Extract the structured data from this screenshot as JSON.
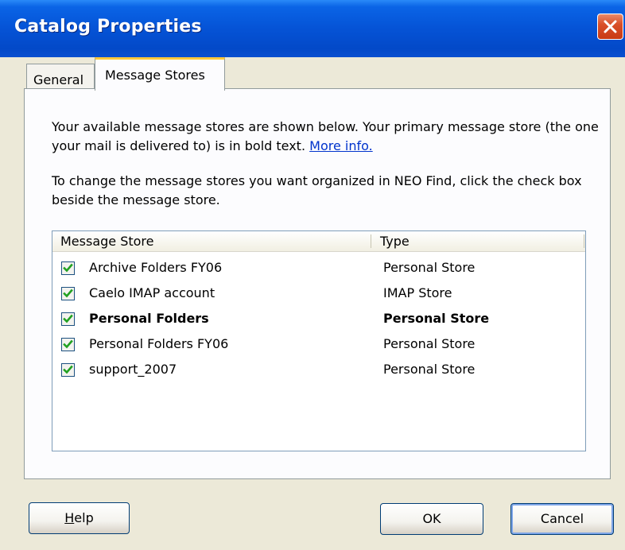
{
  "window": {
    "title": "Catalog Properties"
  },
  "tabs": [
    {
      "label": "General",
      "active": false
    },
    {
      "label": "Message Stores",
      "active": true
    }
  ],
  "content": {
    "para1": "Your available message stores are shown below. Your primary message store (the one your mail is delivered to) is in bold text.",
    "link": "More info.",
    "para2": "To change the message stores you want organized in NEO Find, click the check box beside the message store."
  },
  "list": {
    "columns": [
      "Message Store",
      "Type"
    ],
    "rows": [
      {
        "name": "Archive Folders FY06",
        "type": "Personal Store",
        "checked": true,
        "primary": false
      },
      {
        "name": "Caelo IMAP account",
        "type": "IMAP Store",
        "checked": true,
        "primary": false
      },
      {
        "name": "Personal Folders",
        "type": "Personal Store",
        "checked": true,
        "primary": true
      },
      {
        "name": "Personal Folders FY06",
        "type": "Personal Store",
        "checked": true,
        "primary": false
      },
      {
        "name": "support_2007",
        "type": "Personal Store",
        "checked": true,
        "primary": false
      }
    ]
  },
  "buttons": {
    "help_mnemonic": "H",
    "help_rest": "elp",
    "ok": "OK",
    "cancel": "Cancel"
  },
  "colors": {
    "titlebar": "#0553d6",
    "close": "#d9502a",
    "check": "#21a121",
    "link": "#0033cc"
  },
  "icons": {
    "close": "close-icon",
    "check": "check-icon"
  }
}
